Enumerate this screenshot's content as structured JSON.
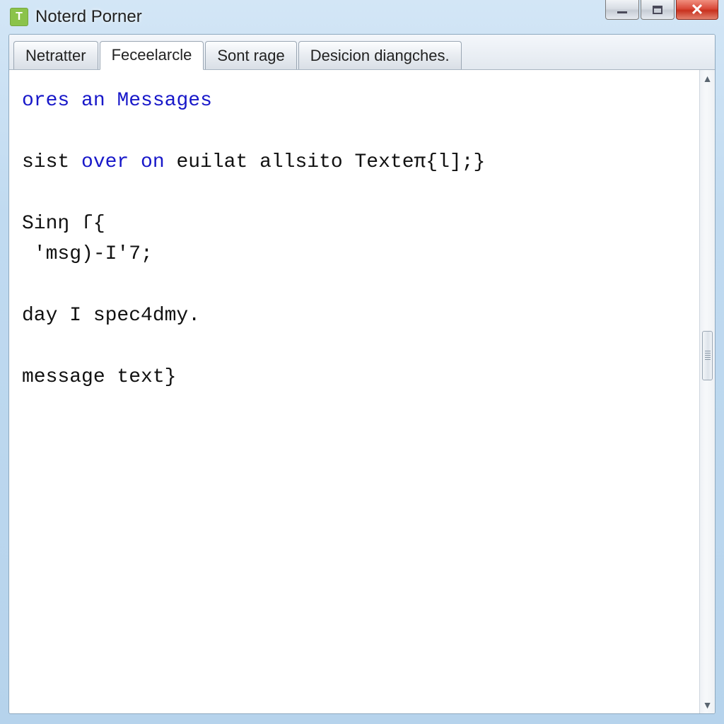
{
  "window": {
    "title": "Noterd Porner",
    "app_icon_letter": "T"
  },
  "tabs": [
    {
      "label": "Netratter",
      "active": false
    },
    {
      "label": "Feceelarcle",
      "active": true
    },
    {
      "label": "Sont rage",
      "active": false
    },
    {
      "label": "Desicion diangches.",
      "active": false
    }
  ],
  "editor": {
    "line1_kw1": "ores",
    "line1_kw2": "an",
    "line1_kw3": "Messages",
    "line2_a": "sist ",
    "line2_kw": "over on",
    "line2_b": " euilat allsito Texteπ{l];}",
    "line3": "Sinŋ ſ{",
    "line4": " 'msg)-I'7;",
    "line5": "day I spec4dmy.",
    "line6": "message text}"
  }
}
